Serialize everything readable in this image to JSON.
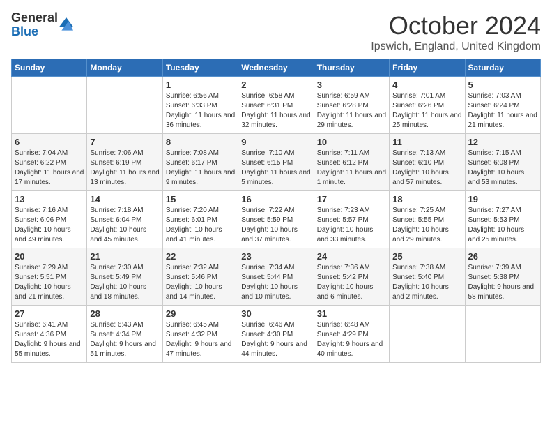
{
  "logo": {
    "line1": "General",
    "line2": "Blue"
  },
  "title": "October 2024",
  "location": "Ipswich, England, United Kingdom",
  "days_header": [
    "Sunday",
    "Monday",
    "Tuesday",
    "Wednesday",
    "Thursday",
    "Friday",
    "Saturday"
  ],
  "weeks": [
    [
      {
        "num": "",
        "info": ""
      },
      {
        "num": "",
        "info": ""
      },
      {
        "num": "1",
        "info": "Sunrise: 6:56 AM\nSunset: 6:33 PM\nDaylight: 11 hours and 36 minutes."
      },
      {
        "num": "2",
        "info": "Sunrise: 6:58 AM\nSunset: 6:31 PM\nDaylight: 11 hours and 32 minutes."
      },
      {
        "num": "3",
        "info": "Sunrise: 6:59 AM\nSunset: 6:28 PM\nDaylight: 11 hours and 29 minutes."
      },
      {
        "num": "4",
        "info": "Sunrise: 7:01 AM\nSunset: 6:26 PM\nDaylight: 11 hours and 25 minutes."
      },
      {
        "num": "5",
        "info": "Sunrise: 7:03 AM\nSunset: 6:24 PM\nDaylight: 11 hours and 21 minutes."
      }
    ],
    [
      {
        "num": "6",
        "info": "Sunrise: 7:04 AM\nSunset: 6:22 PM\nDaylight: 11 hours and 17 minutes."
      },
      {
        "num": "7",
        "info": "Sunrise: 7:06 AM\nSunset: 6:19 PM\nDaylight: 11 hours and 13 minutes."
      },
      {
        "num": "8",
        "info": "Sunrise: 7:08 AM\nSunset: 6:17 PM\nDaylight: 11 hours and 9 minutes."
      },
      {
        "num": "9",
        "info": "Sunrise: 7:10 AM\nSunset: 6:15 PM\nDaylight: 11 hours and 5 minutes."
      },
      {
        "num": "10",
        "info": "Sunrise: 7:11 AM\nSunset: 6:12 PM\nDaylight: 11 hours and 1 minute."
      },
      {
        "num": "11",
        "info": "Sunrise: 7:13 AM\nSunset: 6:10 PM\nDaylight: 10 hours and 57 minutes."
      },
      {
        "num": "12",
        "info": "Sunrise: 7:15 AM\nSunset: 6:08 PM\nDaylight: 10 hours and 53 minutes."
      }
    ],
    [
      {
        "num": "13",
        "info": "Sunrise: 7:16 AM\nSunset: 6:06 PM\nDaylight: 10 hours and 49 minutes."
      },
      {
        "num": "14",
        "info": "Sunrise: 7:18 AM\nSunset: 6:04 PM\nDaylight: 10 hours and 45 minutes."
      },
      {
        "num": "15",
        "info": "Sunrise: 7:20 AM\nSunset: 6:01 PM\nDaylight: 10 hours and 41 minutes."
      },
      {
        "num": "16",
        "info": "Sunrise: 7:22 AM\nSunset: 5:59 PM\nDaylight: 10 hours and 37 minutes."
      },
      {
        "num": "17",
        "info": "Sunrise: 7:23 AM\nSunset: 5:57 PM\nDaylight: 10 hours and 33 minutes."
      },
      {
        "num": "18",
        "info": "Sunrise: 7:25 AM\nSunset: 5:55 PM\nDaylight: 10 hours and 29 minutes."
      },
      {
        "num": "19",
        "info": "Sunrise: 7:27 AM\nSunset: 5:53 PM\nDaylight: 10 hours and 25 minutes."
      }
    ],
    [
      {
        "num": "20",
        "info": "Sunrise: 7:29 AM\nSunset: 5:51 PM\nDaylight: 10 hours and 21 minutes."
      },
      {
        "num": "21",
        "info": "Sunrise: 7:30 AM\nSunset: 5:49 PM\nDaylight: 10 hours and 18 minutes."
      },
      {
        "num": "22",
        "info": "Sunrise: 7:32 AM\nSunset: 5:46 PM\nDaylight: 10 hours and 14 minutes."
      },
      {
        "num": "23",
        "info": "Sunrise: 7:34 AM\nSunset: 5:44 PM\nDaylight: 10 hours and 10 minutes."
      },
      {
        "num": "24",
        "info": "Sunrise: 7:36 AM\nSunset: 5:42 PM\nDaylight: 10 hours and 6 minutes."
      },
      {
        "num": "25",
        "info": "Sunrise: 7:38 AM\nSunset: 5:40 PM\nDaylight: 10 hours and 2 minutes."
      },
      {
        "num": "26",
        "info": "Sunrise: 7:39 AM\nSunset: 5:38 PM\nDaylight: 9 hours and 58 minutes."
      }
    ],
    [
      {
        "num": "27",
        "info": "Sunrise: 6:41 AM\nSunset: 4:36 PM\nDaylight: 9 hours and 55 minutes."
      },
      {
        "num": "28",
        "info": "Sunrise: 6:43 AM\nSunset: 4:34 PM\nDaylight: 9 hours and 51 minutes."
      },
      {
        "num": "29",
        "info": "Sunrise: 6:45 AM\nSunset: 4:32 PM\nDaylight: 9 hours and 47 minutes."
      },
      {
        "num": "30",
        "info": "Sunrise: 6:46 AM\nSunset: 4:30 PM\nDaylight: 9 hours and 44 minutes."
      },
      {
        "num": "31",
        "info": "Sunrise: 6:48 AM\nSunset: 4:29 PM\nDaylight: 9 hours and 40 minutes."
      },
      {
        "num": "",
        "info": ""
      },
      {
        "num": "",
        "info": ""
      }
    ]
  ]
}
